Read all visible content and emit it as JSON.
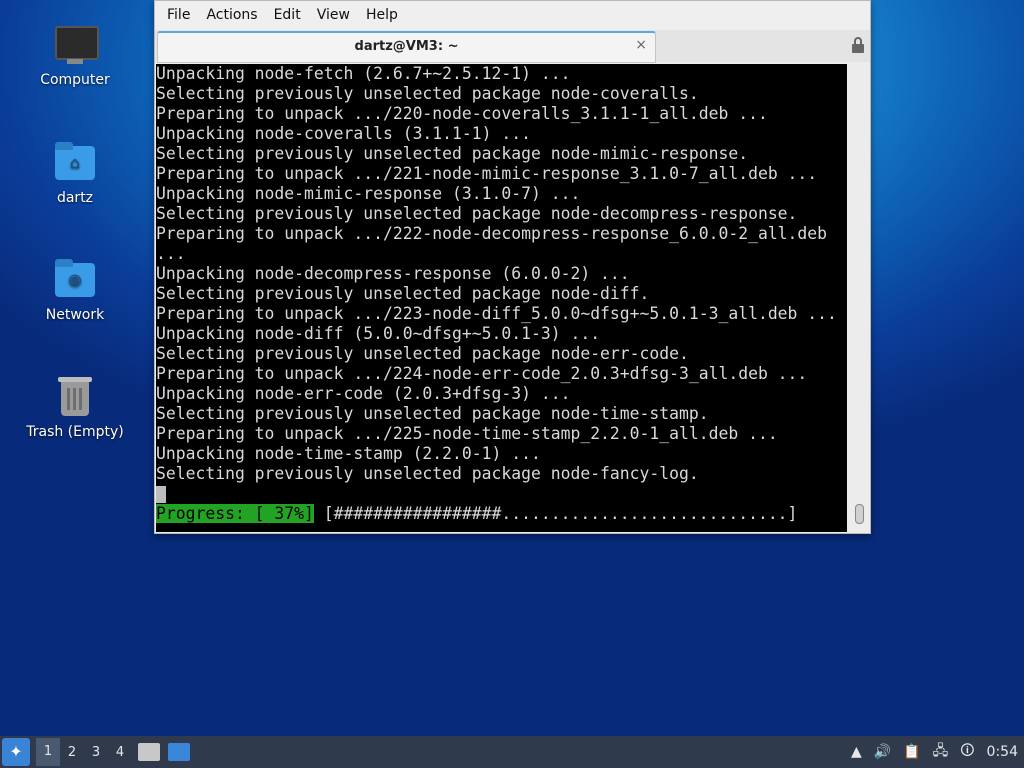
{
  "desktop": {
    "icons": [
      {
        "label": "Computer",
        "icon": "computer-icon"
      },
      {
        "label": "dartz",
        "icon": "home-folder-icon"
      },
      {
        "label": "Network",
        "icon": "network-folder-icon"
      },
      {
        "label": "Trash (Empty)",
        "icon": "trash-icon"
      }
    ]
  },
  "window": {
    "menu": [
      "File",
      "Actions",
      "Edit",
      "View",
      "Help"
    ],
    "tab_title": "dartz@VM3: ~",
    "tab_close": "×",
    "terminal_lines": [
      "Unpacking node-fetch (2.6.7+~2.5.12-1) ...",
      "Selecting previously unselected package node-coveralls.",
      "Preparing to unpack .../220-node-coveralls_3.1.1-1_all.deb ...",
      "Unpacking node-coveralls (3.1.1-1) ...",
      "Selecting previously unselected package node-mimic-response.",
      "Preparing to unpack .../221-node-mimic-response_3.1.0-7_all.deb ...",
      "Unpacking node-mimic-response (3.1.0-7) ...",
      "Selecting previously unselected package node-decompress-response.",
      "Preparing to unpack .../222-node-decompress-response_6.0.0-2_all.deb",
      "...",
      "Unpacking node-decompress-response (6.0.0-2) ...",
      "Selecting previously unselected package node-diff.",
      "Preparing to unpack .../223-node-diff_5.0.0~dfsg+~5.0.1-3_all.deb ...",
      "Unpacking node-diff (5.0.0~dfsg+~5.0.1-3) ...",
      "Selecting previously unselected package node-err-code.",
      "Preparing to unpack .../224-node-err-code_2.0.3+dfsg-3_all.deb ...",
      "Unpacking node-err-code (2.0.3+dfsg-3) ...",
      "Selecting previously unselected package node-time-stamp.",
      "Preparing to unpack .../225-node-time-stamp_2.2.0-1_all.deb ...",
      "Unpacking node-time-stamp (2.2.0-1) ...",
      "Selecting previously unselected package node-fancy-log."
    ],
    "progress_label": "Progress: [ 37%]",
    "progress_bar": " [#################.............................]",
    "progress_percent": 37
  },
  "taskbar": {
    "workspaces": [
      "1",
      "2",
      "3",
      "4"
    ],
    "active_workspace": "1",
    "clock": "0:54"
  }
}
